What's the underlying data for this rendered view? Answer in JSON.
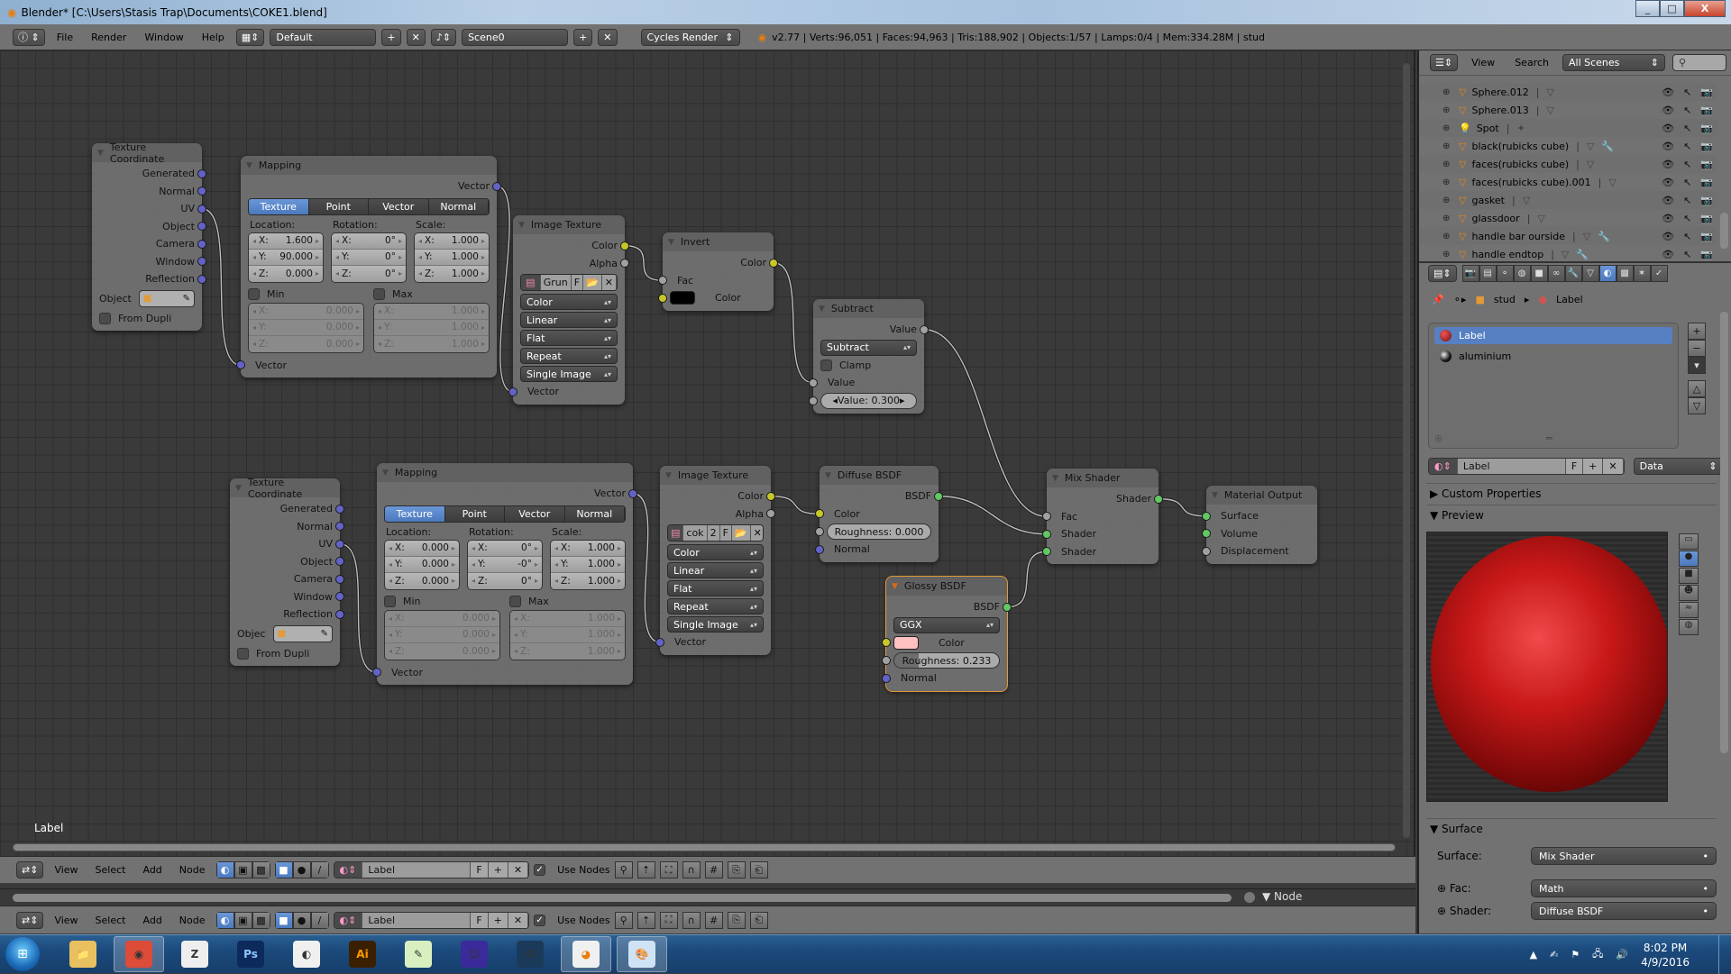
{
  "window": {
    "title": "Blender* [C:\\Users\\Stasis Trap\\Documents\\COKE1.blend]",
    "minimize": "_",
    "maximize": "□",
    "close": "X"
  },
  "info_header": {
    "menus": [
      "File",
      "Render",
      "Window",
      "Help"
    ],
    "layout": "Default",
    "scene": "Scene0",
    "engine": "Cycles Render",
    "stats": "v2.77 | Verts:96,051 | Faces:94,963 | Tris:188,902 | Objects:1/57 | Lamps:0/4 | Mem:334.28M | stud"
  },
  "socket_colors": {
    "blue": "#6363c7",
    "yellow": "#c7c729",
    "gray": "#a1a1a1",
    "green": "#63c763"
  },
  "nodes": [
    {
      "id": "texcoord1",
      "title": "Texture Coordinate",
      "rows": [
        {
          "t": "out",
          "label": "Generated",
          "sock": "blue"
        },
        {
          "t": "out",
          "label": "Normal",
          "sock": "blue"
        },
        {
          "t": "out",
          "label": "UV",
          "sock": "blue"
        },
        {
          "t": "out",
          "label": "Object",
          "sock": "blue"
        },
        {
          "t": "out",
          "label": "Camera",
          "sock": "blue"
        },
        {
          "t": "out",
          "label": "Window",
          "sock": "blue"
        },
        {
          "t": "out",
          "label": "Reflection",
          "sock": "blue"
        },
        {
          "t": "objfield",
          "label": "Object"
        },
        {
          "t": "check",
          "label": "From Dupli",
          "checked": false
        }
      ]
    },
    {
      "id": "mapping1",
      "title": "Mapping",
      "rows": [
        {
          "t": "out",
          "label": "Vector",
          "sock": "blue"
        },
        {
          "t": "tabs",
          "options": [
            "Texture",
            "Point",
            "Vector",
            "Normal"
          ],
          "active": 0
        },
        {
          "t": "vec3",
          "axes": [
            "X:",
            "Y:",
            "Z:"
          ],
          "groups": [
            {
              "label": "Location:",
              "values": [
                "1.600",
                "90.000",
                "0.000"
              ]
            },
            {
              "label": "Rotation:",
              "values": [
                "0°",
                "0°",
                "0°"
              ]
            },
            {
              "label": "Scale:",
              "values": [
                "1.000",
                "1.000",
                "1.000"
              ]
            }
          ]
        },
        {
          "t": "minmax",
          "axes": [
            "X:",
            "Y:",
            "Z:"
          ],
          "groups": [
            {
              "label": "Min",
              "checked": false,
              "values": [
                "0.000",
                "0.000",
                "0.000"
              ]
            },
            {
              "label": "Max",
              "checked": false,
              "values": [
                "1.000",
                "1.000",
                "1.000"
              ]
            }
          ]
        },
        {
          "t": "in",
          "label": "Vector",
          "sock": "blue"
        }
      ]
    },
    {
      "id": "imgtex1",
      "title": "Image Texture",
      "rows": [
        {
          "t": "out",
          "label": "Color",
          "sock": "yellow"
        },
        {
          "t": "out",
          "label": "Alpha",
          "sock": "gray"
        },
        {
          "t": "imgsel",
          "name": "Grun",
          "users": "",
          "fake": "F"
        },
        {
          "t": "select",
          "value": "Color"
        },
        {
          "t": "select",
          "value": "Linear"
        },
        {
          "t": "select",
          "value": "Flat"
        },
        {
          "t": "select",
          "value": "Repeat"
        },
        {
          "t": "select",
          "value": "Single Image"
        },
        {
          "t": "in",
          "label": "Vector",
          "sock": "blue"
        }
      ]
    },
    {
      "id": "invert",
      "title": "Invert",
      "rows": [
        {
          "t": "out",
          "label": "Color",
          "sock": "yellow"
        },
        {
          "t": "in",
          "label": "Fac",
          "sock": "gray"
        },
        {
          "t": "colorin",
          "label": "Color",
          "sock": "yellow",
          "color": "#000000"
        }
      ]
    },
    {
      "id": "subtract",
      "title": "Subtract",
      "rows": [
        {
          "t": "out",
          "label": "Value",
          "sock": "gray"
        },
        {
          "t": "select",
          "value": "Subtract"
        },
        {
          "t": "check",
          "label": "Clamp",
          "checked": false
        },
        {
          "t": "in",
          "label": "Value",
          "sock": "gray"
        },
        {
          "t": "slider",
          "label": "Value:",
          "value": "0.300",
          "sock": "gray",
          "arrows": true
        }
      ]
    },
    {
      "id": "texcoord2",
      "title": "Texture Coordinate",
      "rows": [
        {
          "t": "out",
          "label": "Generated",
          "sock": "blue"
        },
        {
          "t": "out",
          "label": "Normal",
          "sock": "blue"
        },
        {
          "t": "out",
          "label": "UV",
          "sock": "blue"
        },
        {
          "t": "out",
          "label": "Object",
          "sock": "blue"
        },
        {
          "t": "out",
          "label": "Camera",
          "sock": "blue"
        },
        {
          "t": "out",
          "label": "Window",
          "sock": "blue"
        },
        {
          "t": "out",
          "label": "Reflection",
          "sock": "blue"
        },
        {
          "t": "objfield",
          "label": "Objec"
        },
        {
          "t": "check",
          "label": "From Dupli",
          "checked": false
        }
      ]
    },
    {
      "id": "mapping2",
      "title": "Mapping",
      "rows": [
        {
          "t": "out",
          "label": "Vector",
          "sock": "blue"
        },
        {
          "t": "tabs",
          "options": [
            "Texture",
            "Point",
            "Vector",
            "Normal"
          ],
          "active": 0
        },
        {
          "t": "vec3",
          "axes": [
            "X:",
            "Y:",
            "Z:"
          ],
          "groups": [
            {
              "label": "Location:",
              "values": [
                "0.000",
                "0.000",
                "0.000"
              ]
            },
            {
              "label": "Rotation:",
              "values": [
                "0°",
                "-0°",
                "0°"
              ]
            },
            {
              "label": "Scale:",
              "values": [
                "1.000",
                "1.000",
                "1.000"
              ]
            }
          ]
        },
        {
          "t": "minmax",
          "axes": [
            "X:",
            "Y:",
            "Z:"
          ],
          "groups": [
            {
              "label": "Min",
              "checked": false,
              "values": [
                "0.000",
                "0.000",
                "0.000"
              ]
            },
            {
              "label": "Max",
              "checked": false,
              "values": [
                "1.000",
                "1.000",
                "1.000"
              ]
            }
          ]
        },
        {
          "t": "in",
          "label": "Vector",
          "sock": "blue"
        }
      ]
    },
    {
      "id": "imgtex2",
      "title": "Image Texture",
      "rows": [
        {
          "t": "out",
          "label": "Color",
          "sock": "yellow"
        },
        {
          "t": "out",
          "label": "Alpha",
          "sock": "gray"
        },
        {
          "t": "imgsel",
          "name": "cok",
          "users": "2",
          "fake": "F"
        },
        {
          "t": "select",
          "value": "Color"
        },
        {
          "t": "select",
          "value": "Linear"
        },
        {
          "t": "select",
          "value": "Flat"
        },
        {
          "t": "select",
          "value": "Repeat"
        },
        {
          "t": "select",
          "value": "Single Image"
        },
        {
          "t": "in",
          "label": "Vector",
          "sock": "blue"
        }
      ]
    },
    {
      "id": "diffuse",
      "title": "Diffuse BSDF",
      "rows": [
        {
          "t": "out",
          "label": "BSDF",
          "sock": "green"
        },
        {
          "t": "in",
          "label": "Color",
          "sock": "yellow"
        },
        {
          "t": "slider",
          "label": "Roughness:",
          "value": "0.000",
          "sock": "gray",
          "fill": 0.0
        },
        {
          "t": "in",
          "label": "Normal",
          "sock": "blue"
        }
      ]
    },
    {
      "id": "glossy",
      "title": "Glossy BSDF",
      "selected": true,
      "rows": [
        {
          "t": "out",
          "label": "BSDF",
          "sock": "green"
        },
        {
          "t": "select",
          "value": "GGX"
        },
        {
          "t": "colorin",
          "label": "Color",
          "sock": "yellow",
          "color": "#ffc0c0"
        },
        {
          "t": "slider",
          "label": "Roughness:",
          "value": "0.233",
          "sock": "gray",
          "fill": 0.233
        },
        {
          "t": "in",
          "label": "Normal",
          "sock": "blue"
        }
      ]
    },
    {
      "id": "mix",
      "title": "Mix Shader",
      "rows": [
        {
          "t": "out",
          "label": "Shader",
          "sock": "green"
        },
        {
          "t": "in",
          "label": "Fac",
          "sock": "gray"
        },
        {
          "t": "in",
          "label": "Shader",
          "sock": "green"
        },
        {
          "t": "in",
          "label": "Shader",
          "sock": "green"
        }
      ]
    },
    {
      "id": "output",
      "title": "Material Output",
      "rows": [
        {
          "t": "in",
          "label": "Surface",
          "sock": "green"
        },
        {
          "t": "in",
          "label": "Volume",
          "sock": "green"
        },
        {
          "t": "in",
          "label": "Displacement",
          "sock": "gray"
        }
      ]
    }
  ],
  "links": [
    {
      "from": [
        "texcoord1",
        2
      ],
      "to": [
        "mapping1",
        4
      ]
    },
    {
      "from": [
        "mapping1",
        0
      ],
      "to": [
        "imgtex1",
        8
      ]
    },
    {
      "from": [
        "imgtex1",
        0
      ],
      "to": [
        "invert",
        1
      ]
    },
    {
      "from": [
        "invert",
        0
      ],
      "to": [
        "subtract",
        3
      ]
    },
    {
      "from": [
        "subtract",
        0
      ],
      "to": [
        "mix",
        1
      ]
    },
    {
      "from": [
        "texcoord2",
        2
      ],
      "to": [
        "mapping2",
        4
      ]
    },
    {
      "from": [
        "mapping2",
        0
      ],
      "to": [
        "imgtex2",
        8
      ]
    },
    {
      "from": [
        "imgtex2",
        0
      ],
      "to": [
        "diffuse",
        1
      ]
    },
    {
      "from": [
        "diffuse",
        0
      ],
      "to": [
        "mix",
        2
      ]
    },
    {
      "from": [
        "glossy",
        0
      ],
      "to": [
        "mix",
        3
      ]
    },
    {
      "from": [
        "mix",
        0
      ],
      "to": [
        "output",
        0
      ]
    }
  ],
  "node_editor": {
    "active_node_label": "Label"
  },
  "node_header": {
    "menus": [
      "View",
      "Select",
      "Add",
      "Node"
    ],
    "material": "Label",
    "fake_user": "F",
    "use_nodes_label": "Use Nodes",
    "use_nodes": true
  },
  "node_strip": {
    "panel": "Node"
  },
  "outliner": {
    "menus": [
      "View",
      "Search"
    ],
    "filter": "All Scenes",
    "items": [
      {
        "name": "Sphere.012",
        "type": "mesh",
        "modifier": false
      },
      {
        "name": "Sphere.013",
        "type": "mesh",
        "modifier": false
      },
      {
        "name": "Spot",
        "type": "lamp",
        "modifier": false
      },
      {
        "name": "black(rubicks cube)",
        "type": "mesh",
        "modifier": true
      },
      {
        "name": "faces(rubicks cube)",
        "type": "mesh",
        "modifier": false
      },
      {
        "name": "faces(rubicks cube).001",
        "type": "mesh",
        "modifier": false
      },
      {
        "name": "gasket",
        "type": "mesh",
        "modifier": false
      },
      {
        "name": "glassdoor",
        "type": "mesh",
        "modifier": false
      },
      {
        "name": "handle bar ourside",
        "type": "mesh",
        "modifier": true
      },
      {
        "name": "handle endtop",
        "type": "mesh",
        "modifier": true
      }
    ]
  },
  "properties": {
    "tabs": [
      "render",
      "render-layers",
      "scene",
      "world",
      "object",
      "constraints",
      "modifiers",
      "data",
      "material",
      "texture",
      "particles",
      "physics"
    ],
    "active_tab": "material",
    "breadcrumb": [
      "stud",
      "Label"
    ],
    "slots": [
      {
        "name": "Label",
        "selected": true,
        "color": "#b02020"
      },
      {
        "name": "aluminium",
        "selected": false,
        "color": "#222222"
      }
    ],
    "material_field": "Label",
    "fake_user": "F",
    "link": "Data",
    "panels": {
      "custom_properties": "Custom Properties",
      "preview": "Preview",
      "surface": "Surface"
    },
    "surface_rows": [
      {
        "label": "Surface:",
        "value": "Mix Shader"
      },
      {
        "label": "Fac:",
        "value": "Math"
      },
      {
        "label": "Shader:",
        "value": "Diffuse BSDF"
      }
    ]
  },
  "taskbar": {
    "apps": [
      {
        "name": "Windows Explorer",
        "glyph": "📁",
        "active": false,
        "color": "#e8c060"
      },
      {
        "name": "Google Chrome",
        "glyph": "◉",
        "active": true,
        "color": "#dd4b39"
      },
      {
        "name": "ZBrush",
        "glyph": "Z",
        "active": false,
        "color": "#eeeeee"
      },
      {
        "name": "Photoshop",
        "glyph": "Ps",
        "active": false,
        "color": "#0d2a5c"
      },
      {
        "name": "Camera app",
        "glyph": "◐",
        "active": false,
        "color": "#f0f0f0"
      },
      {
        "name": "Illustrator",
        "glyph": "Ai",
        "active": false,
        "color": "#3a2000"
      },
      {
        "name": "Notepad++",
        "glyph": "✎",
        "active": false,
        "color": "#d8f0c0"
      },
      {
        "name": "Media app",
        "glyph": "☺",
        "active": false,
        "color": "#3a2a9a"
      },
      {
        "name": "Steam",
        "glyph": "⚙",
        "active": false,
        "color": "#1b3a5a"
      },
      {
        "name": "Blender",
        "glyph": "◕",
        "active": true,
        "color": "#f0f0f0"
      },
      {
        "name": "Paint",
        "glyph": "🎨",
        "active": true,
        "color": "#cfe3f5"
      }
    ],
    "time": "8:02 PM",
    "date": "4/9/2016"
  }
}
